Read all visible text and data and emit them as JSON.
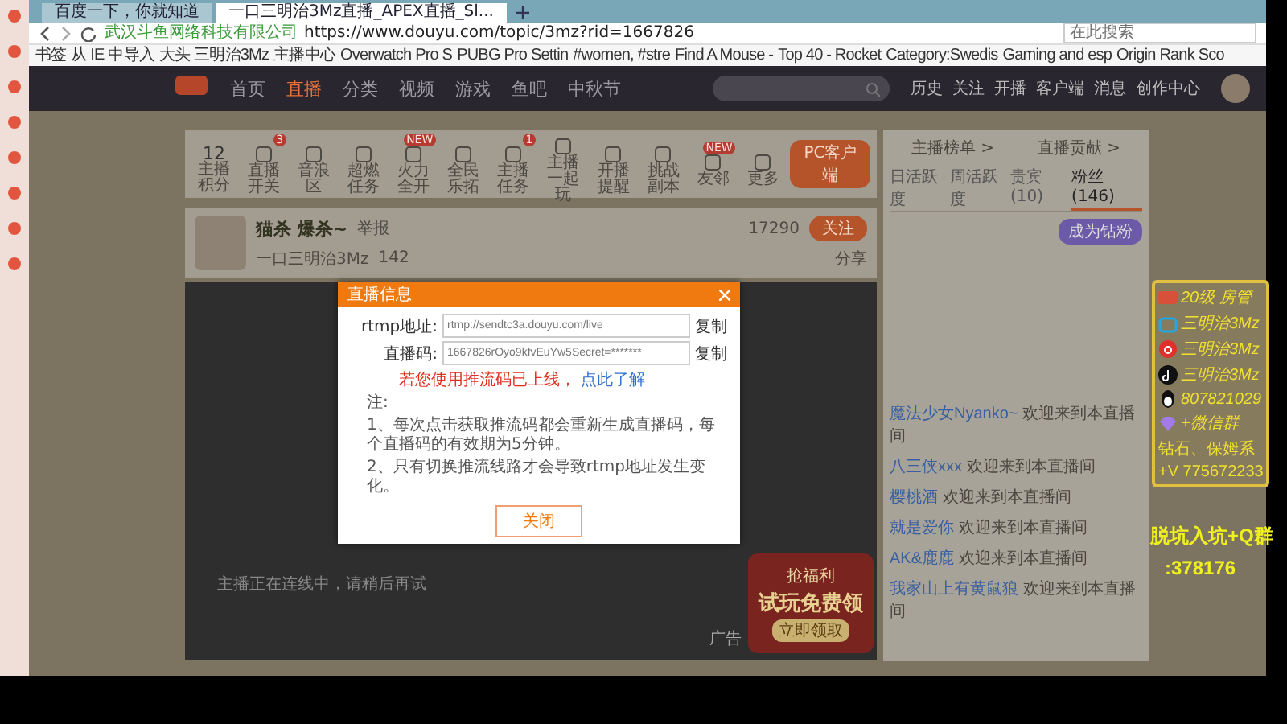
{
  "browser": {
    "tabs": [
      {
        "title": "百度一下，你就知道",
        "selected": false
      },
      {
        "title": "一口三明治3Mz直播_APEX直播_Sl...",
        "selected": true
      }
    ],
    "site": "武汉斗鱼网络科技有限公司",
    "url": "https://www.douyu.com/topic/3mz?rid=1667826",
    "search_placeholder": "在此搜索",
    "bookmarks": [
      "书签",
      "从 IE 中导入",
      "大头 三明治3Mz",
      "主播中心",
      "Overwatch Pro S",
      "PUBG Pro Settin",
      "#women, #stre",
      "Find A Mouse -",
      "Top 40 - Rocket",
      "Category:Swedis",
      "Gaming and esp",
      "Origin Rank Sco"
    ]
  },
  "nav": {
    "items": [
      {
        "label": "首页",
        "selected": false
      },
      {
        "label": "直播",
        "selected": true
      },
      {
        "label": "分类",
        "selected": false
      },
      {
        "label": "视频",
        "selected": false
      },
      {
        "label": "游戏",
        "selected": false
      },
      {
        "label": "鱼吧",
        "selected": false
      },
      {
        "label": "中秋节",
        "selected": false
      }
    ],
    "user_links": [
      "历史",
      "关注",
      "开播",
      "客户端",
      "消息",
      "创作中心"
    ]
  },
  "toolbar": {
    "points": "12",
    "points_label": "主播积分",
    "items": [
      {
        "label": "直播开关",
        "badge": "3"
      },
      {
        "label": "音浪区"
      },
      {
        "label": "超燃任务"
      },
      {
        "label": "火力全开",
        "badge": "NEW"
      },
      {
        "label": "全民乐拓"
      },
      {
        "label": "主播任务",
        "badge": "1"
      },
      {
        "label": "主播一起玩"
      },
      {
        "label": "开播提醒"
      },
      {
        "label": "挑战副本"
      },
      {
        "label": "友邻",
        "badge": "NEW"
      },
      {
        "label": "更多"
      }
    ],
    "client_button": "PC客户端"
  },
  "streamer": {
    "name": "猫杀 爆杀~",
    "report": "举报",
    "room": "一口三明治3Mz",
    "heat": "142",
    "followers": "17290",
    "follow": "关注",
    "share": "分享"
  },
  "video": {
    "message": "主播正在连线中，请稍后再试",
    "ad": [
      "抢福利",
      "试玩免费领",
      "立即领取"
    ],
    "ad_label": "广告"
  },
  "dialog": {
    "title": "直播信息",
    "rtmp_label": "rtmp地址:",
    "rtmp": "rtmp://sendtc3a.douyu.com/live",
    "key_label": "直播码:",
    "key": "1667826rOyo9kfvEuYw5Secret=*******",
    "copy_rtmp": "复制",
    "copy_key": "复制",
    "warning": "若您使用推流码已上线，",
    "learn": "点此了解",
    "notes": [
      "注:",
      "1、每次点击获取推流码都会重新生成直播码，每个直播码的有效期为5分钟。",
      "2、只有切换推流线路才会导致rtmp地址发生变化。"
    ],
    "close": "关闭"
  },
  "chat": {
    "links": [
      "主播榜单 >",
      "直播贡献 >"
    ],
    "tabs": [
      {
        "label": "日活跃度",
        "selected": false
      },
      {
        "label": "周活跃度",
        "selected": false
      },
      {
        "label": "贵宾(10)",
        "selected": false
      },
      {
        "label": "粉丝(146)",
        "selected": true
      }
    ],
    "fan_button": "成为钻粉",
    "messages": [
      {
        "user": "魔法少女Nyanko~",
        "text": "欢迎来到本直播间"
      },
      {
        "user": "八三侠xxx",
        "text": "欢迎来到本直播间"
      },
      {
        "user": "樱桃酒",
        "text": "欢迎来到本直播间"
      },
      {
        "user": "就是爱你",
        "text": "欢迎来到本直播间"
      },
      {
        "user": "AK&鹿鹿",
        "text": "欢迎来到本直播间"
      },
      {
        "user": "我家山上有黄鼠狼",
        "text": "欢迎来到本直播间"
      }
    ]
  },
  "overlay": {
    "lines": [
      {
        "kind": "badge",
        "text": "20级 房管"
      },
      {
        "kind": "tv",
        "text": "三明治3Mz"
      },
      {
        "kind": "music",
        "text": "三明治3Mz"
      },
      {
        "kind": "note",
        "text": "三明治3Mz"
      },
      {
        "kind": "penguin",
        "text": "807821029"
      },
      {
        "kind": "gem",
        "text": "+微信群"
      },
      {
        "kind": "plain",
        "text": "钻石、保姆系"
      },
      {
        "kind": "plain",
        "text": "+V 775672233"
      }
    ],
    "group": "脱坑入坑+Q群",
    "group_number": ":378176"
  }
}
